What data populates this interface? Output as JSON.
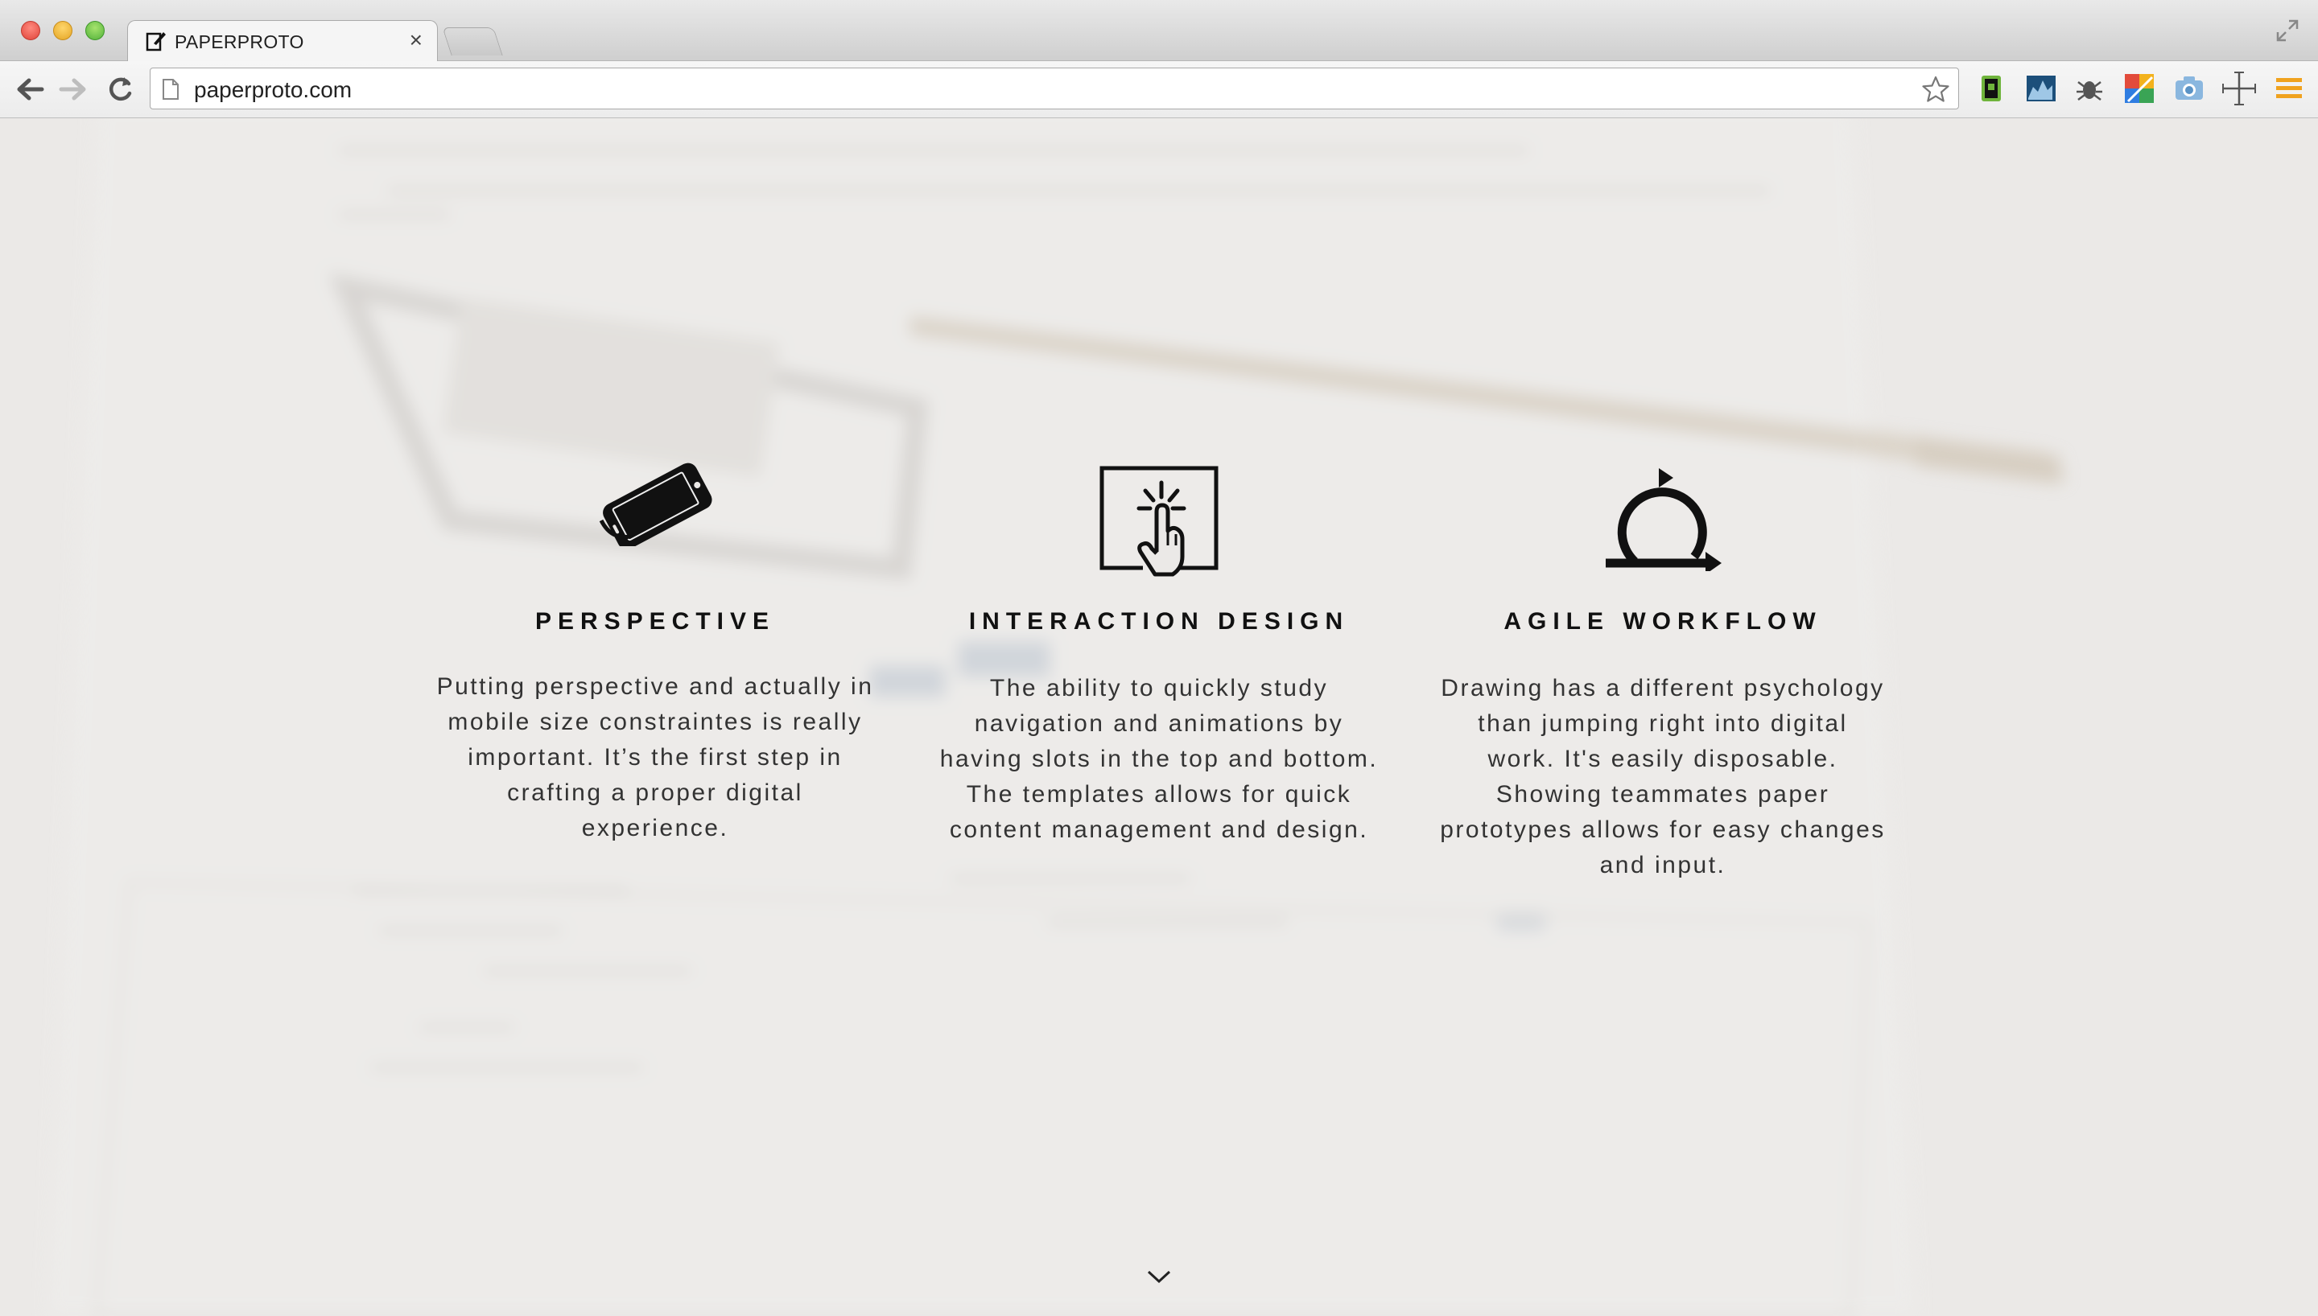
{
  "browser": {
    "tab_title": "PAPERPROTO",
    "tab_close": "×",
    "url": "paperproto.com",
    "extensions": [
      "evernote-icon",
      "chart-icon",
      "bug-icon",
      "colorful-grid-icon",
      "camera-icon",
      "crosshair-icon",
      "menu-icon"
    ]
  },
  "features": [
    {
      "icon": "smartphone-icon",
      "title": "PERSPECTIVE",
      "lines": [
        "Putting perspective and actually in",
        "mobile size constraintes is really",
        "important. It’s the first step in",
        "crafting a proper digital",
        "experience."
      ]
    },
    {
      "icon": "touch-screen-icon",
      "title": "INTERACTION DESIGN",
      "lines": [
        "The ability to quickly study",
        "navigation and animations by",
        "having slots in the top and bottom.",
        "The templates allows for quick",
        "content management and design."
      ]
    },
    {
      "icon": "agile-cycle-icon",
      "title": "AGILE WORKFLOW",
      "lines": [
        "Drawing has a different psychology",
        "than jumping right into digital",
        "work. It's easily disposable.",
        "Showing teammates paper",
        "prototypes allows for easy changes",
        "and input."
      ]
    }
  ],
  "colors": {
    "page_bg": "#ebe9e7",
    "text": "#333333",
    "heading": "#111111"
  }
}
